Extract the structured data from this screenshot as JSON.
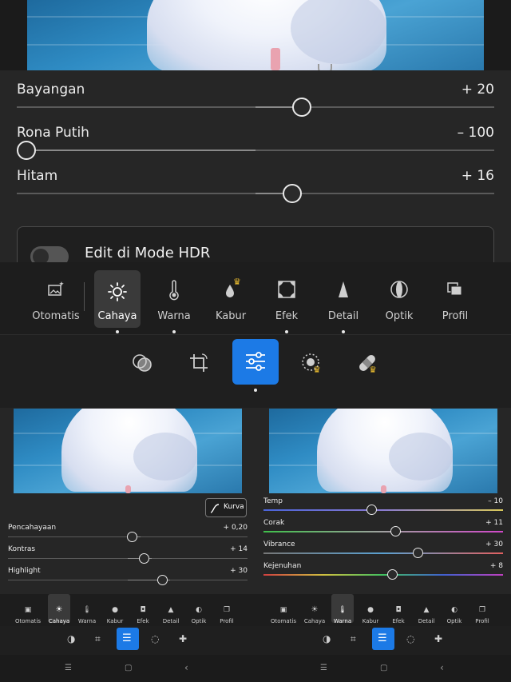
{
  "main": {
    "sliders": [
      {
        "label": "Bayangan",
        "value": "+ 20",
        "level": 0.6
      },
      {
        "label": "Rona Putih",
        "value": "– 100",
        "level": 0.0
      },
      {
        "label": "Hitam",
        "value": "+ 16",
        "level": 0.58
      }
    ],
    "hdr_label": "Edit di Mode HDR",
    "tools": [
      {
        "label": "Otomatis",
        "icon": "auto-photo-icon"
      },
      {
        "label": "Cahaya",
        "icon": "sun-icon"
      },
      {
        "label": "Warna",
        "icon": "thermometer-icon"
      },
      {
        "label": "Kabur",
        "icon": "droplet-icon"
      },
      {
        "label": "Efek",
        "icon": "vignette-square-icon"
      },
      {
        "label": "Detail",
        "icon": "triangle-icon"
      },
      {
        "label": "Optik",
        "icon": "lens-icon"
      },
      {
        "label": "Profil",
        "icon": "stacked-squares-icon"
      }
    ],
    "selected_tool": "Cahaya"
  },
  "left_panel": {
    "curve_button": "Kurva",
    "sliders": [
      {
        "label": "Pencahayaan",
        "value": "+ 0,20",
        "level": 0.52
      },
      {
        "label": "Kontras",
        "value": "+ 14",
        "level": 0.57
      },
      {
        "label": "Highlight",
        "value": "+ 30",
        "level": 0.65
      }
    ],
    "selected_tool": "Cahaya"
  },
  "right_panel": {
    "sliders": [
      {
        "label": "Temp",
        "value": "– 10",
        "level": 0.45
      },
      {
        "label": "Corak",
        "value": "+ 11",
        "level": 0.55
      },
      {
        "label": "Vibrance",
        "value": "+ 30",
        "level": 0.65
      },
      {
        "label": "Kejenuhan",
        "value": "+ 8",
        "level": 0.54
      }
    ],
    "selected_tool": "Warna"
  },
  "colors": {
    "accent": "#1c7ae6",
    "crown": "#f2c230",
    "background": "#1b1b1b"
  }
}
